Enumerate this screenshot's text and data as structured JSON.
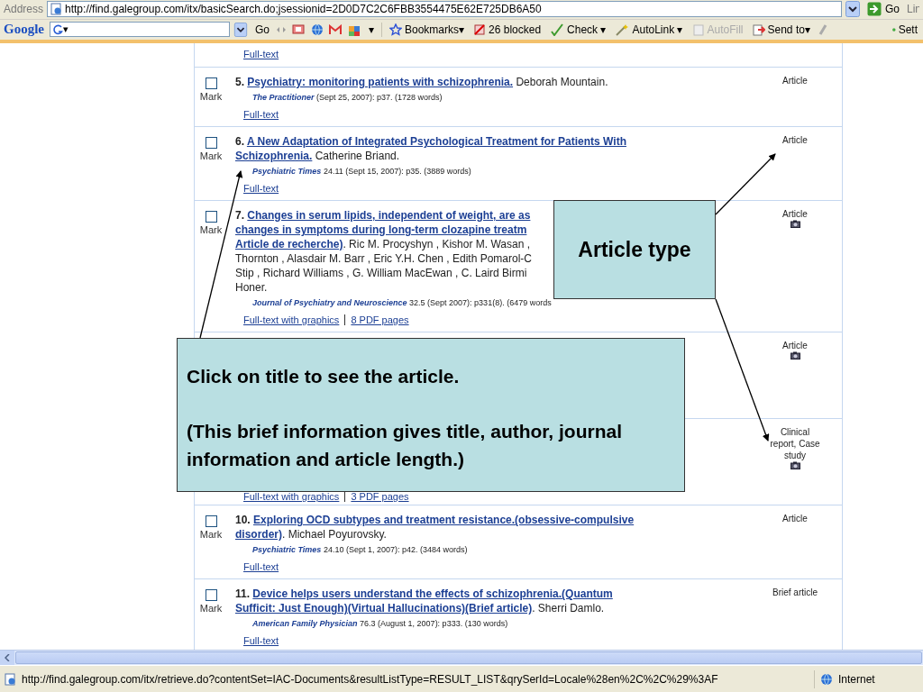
{
  "address_bar": {
    "label": "Address",
    "url": "http://find.galegroup.com/itx/basicSearch.do;jsessionid=2D0D7C2C6FBB3554475E62E725DB6A50",
    "go": "Go",
    "links_cut": "Lin"
  },
  "google_toolbar": {
    "logo": "Google",
    "field_caret": "▾",
    "go": "Go",
    "caret": "▾",
    "buttons": [
      {
        "label": "Bookmarks▾",
        "disabled": false
      },
      {
        "label": "26 blocked",
        "disabled": false
      },
      {
        "label": "Check ▾",
        "disabled": false
      },
      {
        "label": "AutoLink ▾",
        "disabled": false
      },
      {
        "label": "AutoFill",
        "disabled": true
      },
      {
        "label": "Send to▾",
        "disabled": false
      }
    ],
    "settings_cut": "Sett"
  },
  "results": [
    {
      "kind": "tail",
      "links": [
        "Full-text"
      ]
    },
    {
      "kind": "full",
      "checked": false,
      "mark": "Mark",
      "type": "Article",
      "image_icon": false,
      "lines": [
        {
          "number": "5.",
          "title": "Psychiatry: monitoring patients with schizophrenia.",
          "authors": " Deborah Mountain."
        }
      ],
      "journal": "The Practitioner",
      "details": " (Sept 25, 2007): p37. (1728 words)",
      "links": [
        "Full-text"
      ]
    },
    {
      "kind": "full",
      "checked": false,
      "mark": "Mark",
      "type": "Article",
      "image_icon": false,
      "lines": [
        {
          "number": "6.",
          "title": "A New Adaptation of Integrated Psychological Treatment for Patients With"
        },
        {
          "title": "Schizophrenia.",
          "authors": " Catherine Briand."
        }
      ],
      "journal": "Psychiatric Times",
      "details": " 24.11 (Sept 15, 2007): p35. (3889 words)",
      "links": [
        "Full-text"
      ]
    },
    {
      "kind": "full",
      "checked": false,
      "mark": "Mark",
      "type": "Article",
      "image_icon": true,
      "lines": [
        {
          "number": "7.",
          "title": "Changes in serum lipids, independent of weight, are as"
        },
        {
          "title": "changes in symptoms during long-term clozapine treatm"
        },
        {
          "title": "Article de recherche)",
          "authors": ". Ric M. Procyshyn , Kishor M. Wasan ,"
        },
        {
          "authors": "Thornton , Alasdair M. Barr , Eric Y.H. Chen , Edith Pomarol-C"
        },
        {
          "authors": "Stip , Richard Williams , G. William MacEwan , C. Laird Birmi"
        },
        {
          "authors": "Honer."
        }
      ],
      "journal": "Journal of Psychiatry and Neuroscience",
      "details": " 32.5 (Sept 2007): p331(8). (6479 words",
      "links": [
        "Full-text with graphics",
        "8 PDF pages"
      ]
    },
    {
      "kind": "covered",
      "type": "Article",
      "image_icon": true
    },
    {
      "kind": "covered",
      "type": "Clinical report, Case study",
      "image_icon": true,
      "links": [
        "Full-text with graphics",
        "3 PDF pages"
      ]
    },
    {
      "kind": "full",
      "checked": false,
      "mark": "Mark",
      "type": "Article",
      "image_icon": false,
      "lines": [
        {
          "number": "10.",
          "title": "Exploring OCD subtypes and treatment resistance.(obsessive-compulsive"
        },
        {
          "title": "disorder)",
          "authors": ". Michael Poyurovsky."
        }
      ],
      "journal": "Psychiatric Times",
      "details": " 24.10 (Sept 1, 2007): p42. (3484 words)",
      "links": [
        "Full-text"
      ]
    },
    {
      "kind": "full",
      "checked": false,
      "mark": "Mark",
      "type": "Brief article",
      "image_icon": false,
      "lines": [
        {
          "number": "11.",
          "title": "Device helps users understand the effects of schizophrenia.(Quantum"
        },
        {
          "title": "Sufficit: Just Enough)(Virtual Hallucinations)(Brief article)",
          "authors": ". Sherri Damlo."
        }
      ],
      "journal": "American Family Physician",
      "details": " 76.3 (August 1, 2007): p333. (130 words)",
      "links": [
        "Full-text"
      ]
    }
  ],
  "callouts": [
    {
      "kind": "small",
      "paragraphs": [
        "Article type"
      ]
    },
    {
      "kind": "large",
      "paragraphs": [
        "Click on title to see the article.",
        "(This brief information gives title, author, journal information and article length.)"
      ]
    }
  ],
  "status_bar": {
    "url": "http://find.galegroup.com/itx/retrieve.do?contentSet=IAC-Documents&resultListType=RESULT_LIST&qrySerId=Locale%28en%2C%2C%29%3AF",
    "zone": "Internet"
  }
}
